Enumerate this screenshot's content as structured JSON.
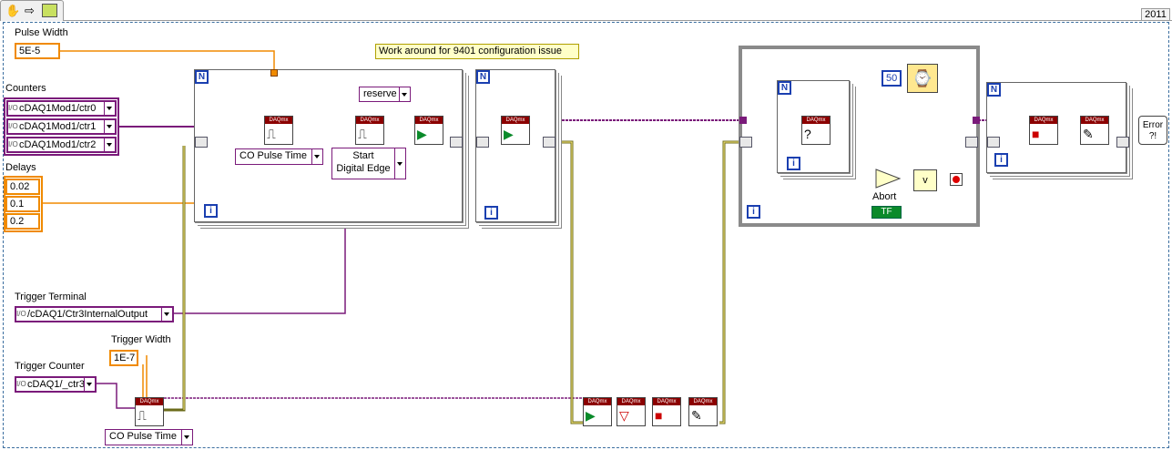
{
  "toolbar": {
    "version": "2011",
    "icons": [
      "hand-tool-icon",
      "arrow-tool-icon",
      "run-icon"
    ]
  },
  "comment": "Work around for 9401 configuration issue",
  "pulse_width": {
    "label": "Pulse Width",
    "value": "5E-5"
  },
  "counters": {
    "label": "Counters",
    "items": [
      "cDAQ1Mod1/ctr0",
      "cDAQ1Mod1/ctr1",
      "cDAQ1Mod1/ctr2"
    ]
  },
  "delays": {
    "label": "Delays",
    "items": [
      "0.02",
      "0.1",
      "0.2"
    ]
  },
  "trigger_terminal": {
    "label": "Trigger Terminal",
    "value": "/cDAQ1/Ctr3InternalOutput"
  },
  "trigger_width": {
    "label": "Trigger Width",
    "value": "1E-7"
  },
  "trigger_counter": {
    "label": "Trigger Counter",
    "value": "cDAQ1/_ctr3"
  },
  "co_pulse_time_1": "CO Pulse Time",
  "co_pulse_time_2": "CO Pulse Time",
  "trigger_type": {
    "line1": "Start",
    "line2": "Digital Edge"
  },
  "reserve": "reserve",
  "wait_ms": "50",
  "abort_label": "Abort",
  "bool_const": "TF",
  "loop_n": "N",
  "loop_i": "i",
  "daqmx": "DAQmx",
  "error_label": "Error ?!",
  "or_label": "v"
}
